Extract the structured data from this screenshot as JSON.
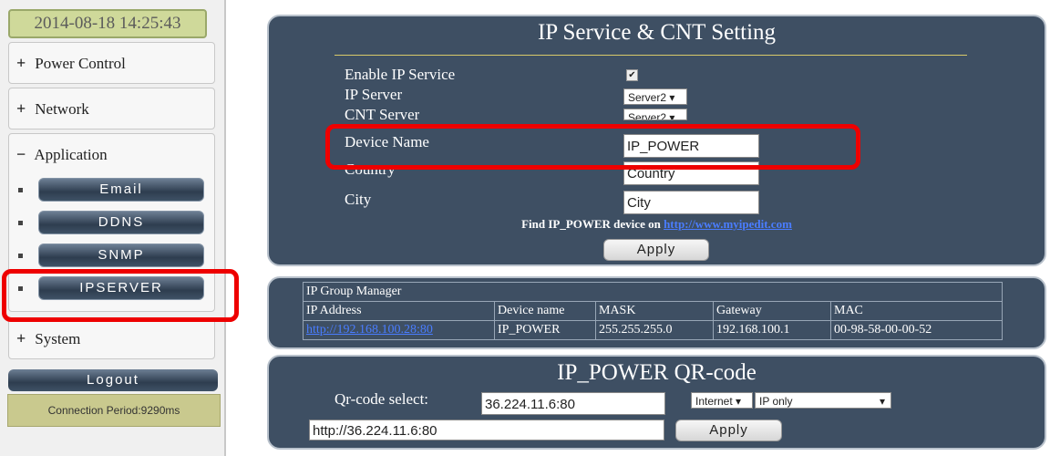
{
  "sidebar": {
    "clock": "2014-08-18 14:25:43",
    "power_control": {
      "sign": "+",
      "label": "Power Control"
    },
    "network": {
      "sign": "+",
      "label": "Network"
    },
    "application": {
      "sign": "−",
      "label": "Application",
      "items": [
        "Email",
        "DDNS",
        "SNMP",
        "IPSERVER"
      ]
    },
    "system": {
      "sign": "+",
      "label": "System"
    },
    "logout": "Logout",
    "connection": "Connection Period:9290ms"
  },
  "ip_service": {
    "title": "IP Service & CNT Setting",
    "enable_label": "Enable IP Service",
    "enable_checked": "✔",
    "ip_server_label": "IP Server",
    "ip_server_value": "Server2 ▾",
    "cnt_server_label": "CNT Server",
    "cnt_server_value": "Server2 ▾",
    "device_name_label": "Device Name",
    "device_name_value": "IP_POWER",
    "country_label": "Country",
    "country_value": "Country",
    "city_label": "City",
    "city_value": "City",
    "find_text": "Find IP_POWER  device on ",
    "find_link": "http://www.myipedit.com",
    "apply": "Apply"
  },
  "group_manager": {
    "caption": "IP Group Manager",
    "headers": [
      "IP Address",
      "Device name",
      "MASK",
      "Gateway",
      "MAC"
    ],
    "rows": [
      [
        "http://192.168.100.28:80",
        "IP_POWER",
        "255.255.255.0",
        "192.168.100.1",
        "00-98-58-00-00-52"
      ]
    ]
  },
  "qr": {
    "title": "IP_POWER  QR-code",
    "select_label": "Qr-code select:",
    "address_value": "36.224.11.6:80",
    "network_select": "Internet ▾",
    "mode_select": "IP only",
    "mode_arrow": "▾",
    "url_value": "http://36.224.11.6:80",
    "apply": "Apply"
  },
  "colors": {
    "panel": "#3e4f63",
    "highlight": "#ee0000",
    "clock_bg": "#cfd99a",
    "link": "#4a7dff"
  }
}
